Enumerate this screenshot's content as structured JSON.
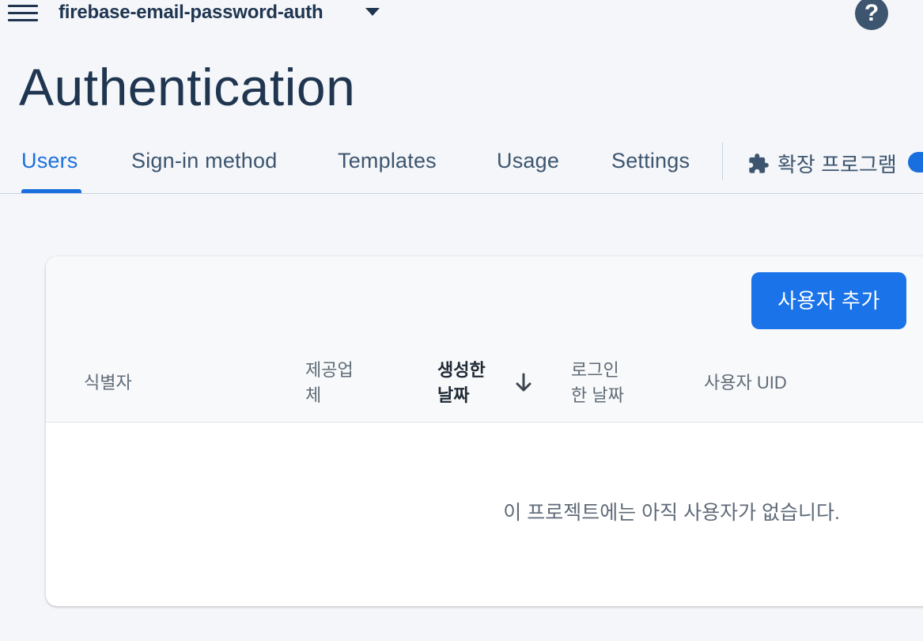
{
  "topbar": {
    "project_name": "firebase-email-password-auth",
    "help_label": "?"
  },
  "page": {
    "title": "Authentication"
  },
  "tabs": [
    {
      "label": "Users",
      "active": true
    },
    {
      "label": "Sign-in method",
      "active": false
    },
    {
      "label": "Templates",
      "active": false
    },
    {
      "label": "Usage",
      "active": false
    },
    {
      "label": "Settings",
      "active": false
    }
  ],
  "extensions_tab": {
    "label": "확장 프로그램",
    "icon": "puzzle-icon"
  },
  "users_table": {
    "add_user_label": "사용자 추가",
    "columns": [
      {
        "line1": "식별자",
        "line2": ""
      },
      {
        "line1": "제공업",
        "line2": "체"
      },
      {
        "line1": "생성한",
        "line2": "날짜",
        "sorted": "desc"
      },
      {
        "line1": "로그인",
        "line2": "한 날짜"
      },
      {
        "line1": "사용자 UID",
        "line2": ""
      }
    ],
    "empty_message": "이 프로젝트에는 아직 사용자가 없습니다."
  },
  "colors": {
    "accent": "#1a73e8",
    "background": "#f4f6f9",
    "text_primary": "#1f3550"
  }
}
